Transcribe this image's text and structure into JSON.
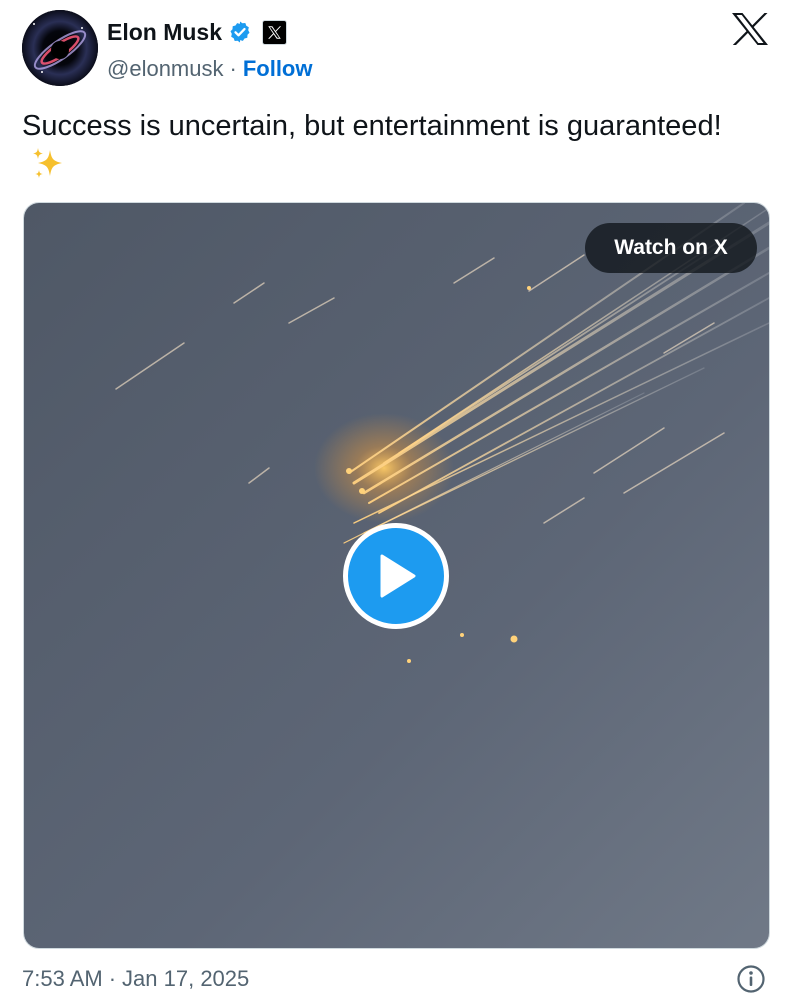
{
  "author": {
    "display_name": "Elon Musk",
    "handle": "@elonmusk",
    "separator": "·",
    "follow_label": "Follow",
    "verified_icon": "verified-badge-icon",
    "affiliation_icon": "x-affiliation-icon"
  },
  "tweet": {
    "text": "Success is uncertain, but entertainment is guaranteed!",
    "emoji_icon": "sparkles-icon"
  },
  "media": {
    "type": "video",
    "watch_label": "Watch on X",
    "play_icon": "play-icon"
  },
  "footer": {
    "time": "7:53 AM",
    "separator": "·",
    "date": "Jan 17, 2025",
    "info_icon": "info-icon"
  },
  "colors": {
    "accent": "#1d9bf0",
    "follow_link": "#006fd6",
    "secondary_text": "#536471",
    "primary_text": "#0f1419"
  }
}
